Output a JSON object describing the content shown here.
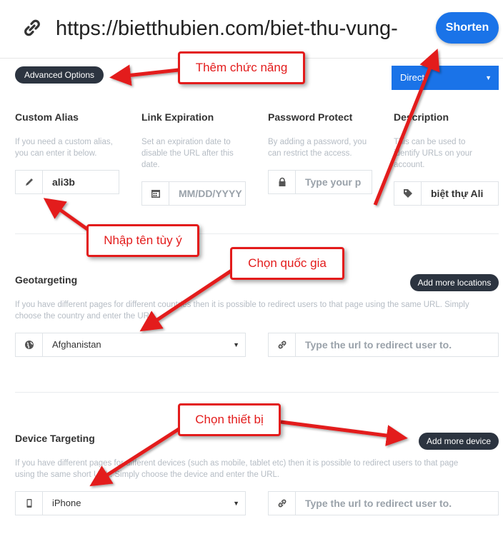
{
  "url_bar": {
    "value": "https://bietthubien.com/biet-thu-vung-",
    "shorten_label": "Shorten",
    "icon": "link-icon"
  },
  "advanced_options_label": "Advanced Options",
  "redirect_type": {
    "selected": "Direct"
  },
  "custom_alias": {
    "label": "Custom Alias",
    "help": [
      "If you need a custom alias,",
      "you can enter it below."
    ],
    "value": "ali3b",
    "icon": "pencil-icon"
  },
  "link_expiration": {
    "label": "Link Expiration",
    "help": [
      "Set an expiration date to",
      "disable the URL after this",
      "date."
    ],
    "placeholder": "MM/DD/YYYY",
    "icon": "calendar-icon"
  },
  "password_protect": {
    "label": "Password Protect",
    "help": [
      "By adding a password, you",
      "can restrict the access."
    ],
    "placeholder": "Type your p",
    "icon": "lock-icon"
  },
  "description": {
    "label": "Description",
    "help": [
      "This can be used to",
      "identify URLs on your",
      "account."
    ],
    "value": "biệt thự Ali",
    "icon": "tag-icon"
  },
  "geotargeting": {
    "label": "Geotargeting",
    "add_label": "Add more locations",
    "help": [
      "If you have different pages for different countries then it is possible to redirect users to that page using the same URL. Simply",
      "choose the country and enter the URL."
    ],
    "country": "Afghanistan",
    "url_placeholder": "Type the url to redirect user to.",
    "icon": "globe-icon"
  },
  "device_targeting": {
    "label": "Device Targeting",
    "add_label": "Add more device",
    "help": [
      "If you have different pages for different devices (such as mobile, tablet etc) then it is possible to redirect users to that page",
      "using the same short URL. Simply choose the device and enter the URL."
    ],
    "device": "iPhone",
    "url_placeholder": "Type the url to redirect user to.",
    "icon": "phone-icon"
  },
  "annotations": {
    "them_chuc_nang": "Thêm chức năng",
    "nhap_ten": "Nhập tên tùy ý",
    "chon_quoc_gia": "Chọn quốc gia",
    "chon_thiet_bi": "Chọn thiết bị",
    "color": "#e31b1b"
  }
}
